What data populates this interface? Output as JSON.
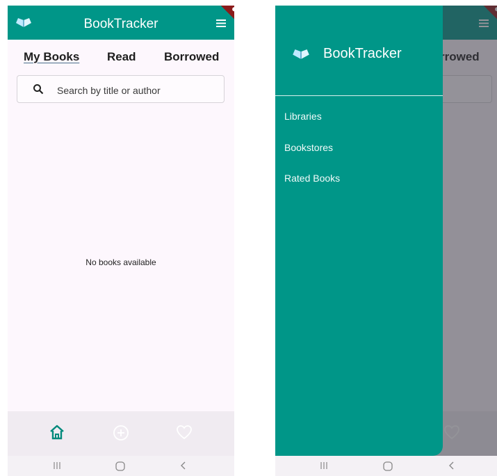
{
  "app": {
    "title": "BookTracker"
  },
  "tabs": [
    "My Books",
    "Read",
    "Borrowed"
  ],
  "search": {
    "placeholder": "Search by title or author"
  },
  "main": {
    "empty_message": "No books available"
  },
  "drawer": {
    "title": "BookTracker",
    "items": [
      "Libraries",
      "Bookstores",
      "Rated Books"
    ]
  },
  "right_overlay": {
    "visible_tab_fragment": "rrowed"
  },
  "bottom_nav": {
    "items": [
      "home-icon",
      "add-circle-icon",
      "heart-icon"
    ],
    "active": "home-icon"
  },
  "system_nav": {
    "buttons": [
      "recents-icon",
      "home-circle-icon",
      "back-icon"
    ]
  },
  "colors": {
    "primary": "#009688",
    "background": "#fdf7fd",
    "bottom_nav": "#f0ebf1",
    "active_icon": "#00897b",
    "debug_banner": "#8b1b1b"
  }
}
